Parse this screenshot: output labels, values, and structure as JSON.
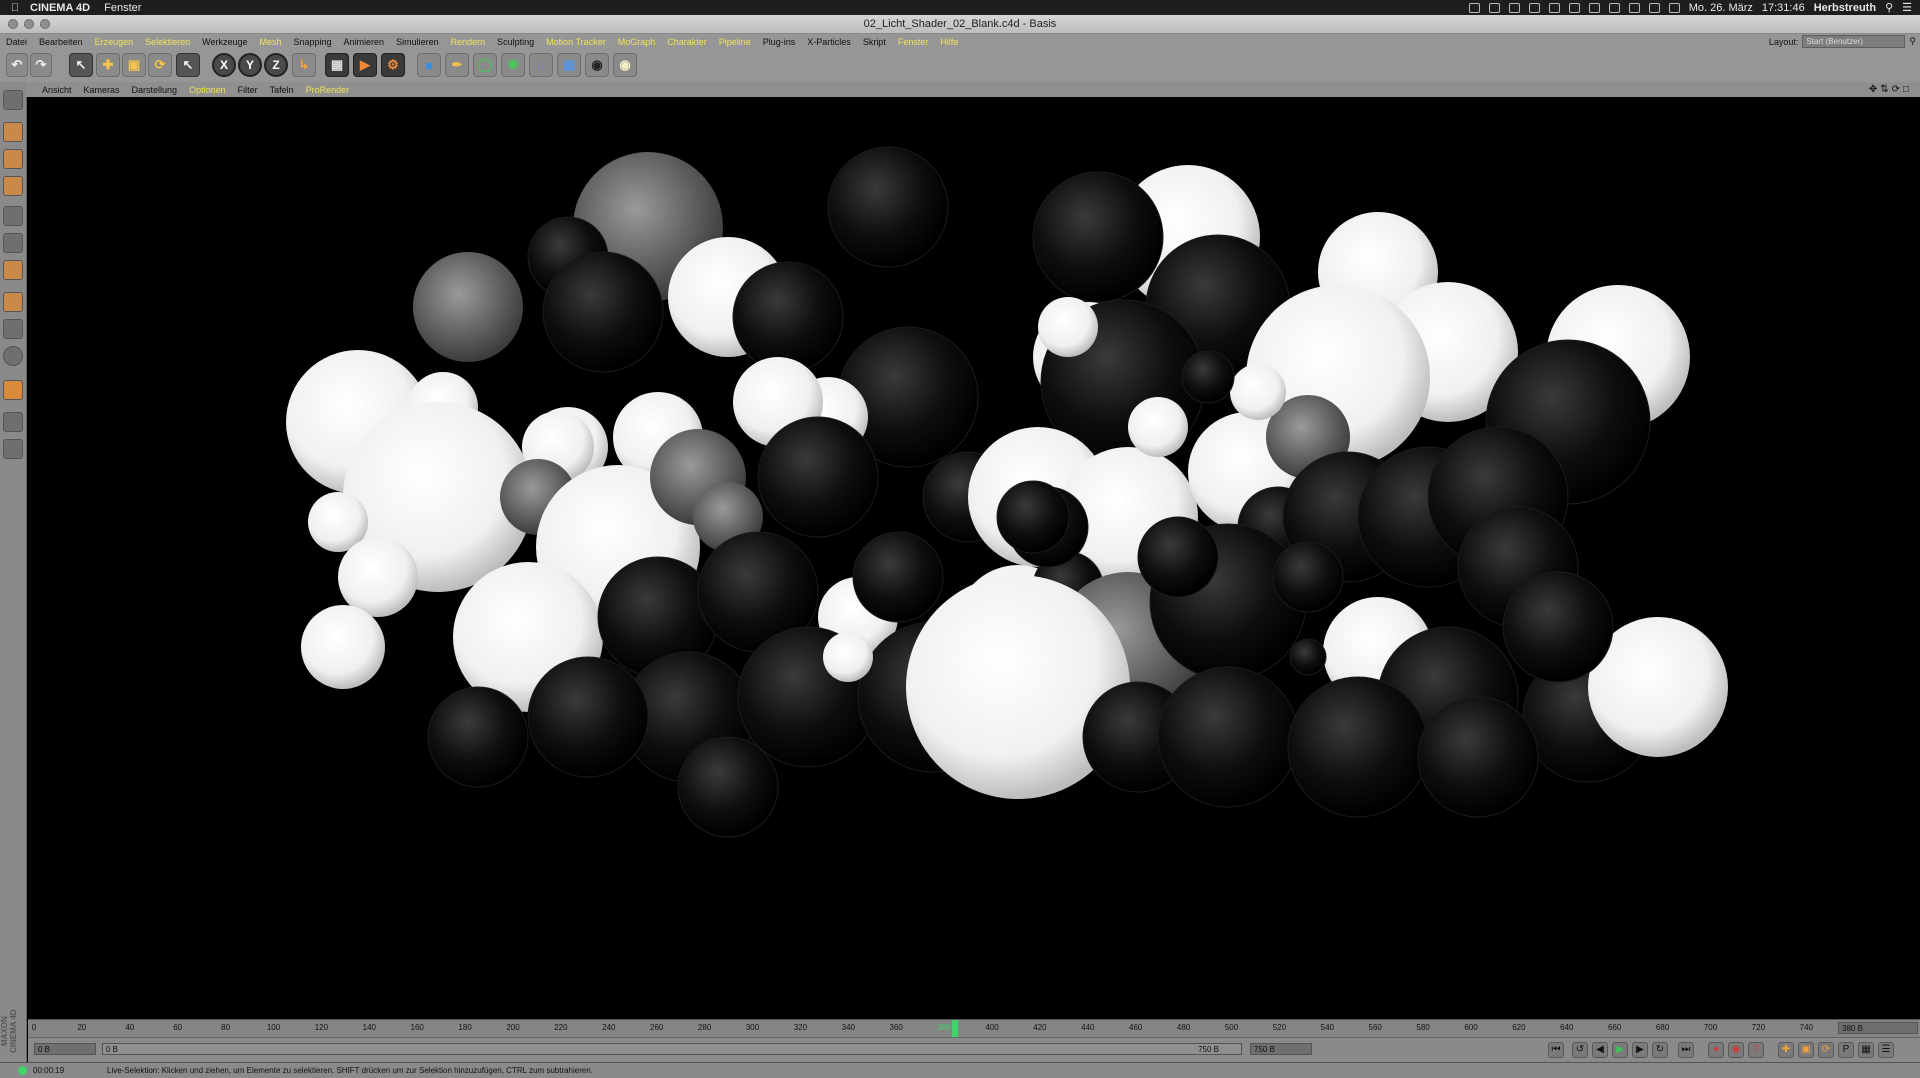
{
  "menubar": {
    "apple": "",
    "app_name": "CINEMA 4D",
    "menu": "Fenster",
    "date": "Mo. 26. März",
    "time": "17:31:46",
    "user": "Herbstreuth"
  },
  "window": {
    "title": "02_Licht_Shader_02_Blank.c4d - Basis"
  },
  "main_menu": [
    {
      "label": "Datei",
      "hl": false
    },
    {
      "label": "Bearbeiten",
      "hl": false
    },
    {
      "label": "Erzeugen",
      "hl": true
    },
    {
      "label": "Selektieren",
      "hl": true
    },
    {
      "label": "Werkzeuge",
      "hl": false
    },
    {
      "label": "Mesh",
      "hl": true
    },
    {
      "label": "Snapping",
      "hl": false
    },
    {
      "label": "Animieren",
      "hl": false
    },
    {
      "label": "Simulieren",
      "hl": false
    },
    {
      "label": "Rendern",
      "hl": true
    },
    {
      "label": "Sculpting",
      "hl": false
    },
    {
      "label": "Motion Tracker",
      "hl": true
    },
    {
      "label": "MoGraph",
      "hl": true
    },
    {
      "label": "Charakter",
      "hl": true
    },
    {
      "label": "Pipeline",
      "hl": true
    },
    {
      "label": "Plug-ins",
      "hl": false
    },
    {
      "label": "X-Particles",
      "hl": false
    },
    {
      "label": "Skript",
      "hl": false
    },
    {
      "label": "Fenster",
      "hl": true
    },
    {
      "label": "Hilfe",
      "hl": true
    }
  ],
  "layout": {
    "label": "Layout:",
    "value": "Start (Benutzer)"
  },
  "toolbar": {
    "x_label": "X",
    "y_label": "Y",
    "z_label": "Z"
  },
  "viewport_menu": [
    {
      "label": "Ansicht",
      "hl": false
    },
    {
      "label": "Kameras",
      "hl": false
    },
    {
      "label": "Darstellung",
      "hl": false
    },
    {
      "label": "Optionen",
      "hl": true
    },
    {
      "label": "Filter",
      "hl": false
    },
    {
      "label": "Tafeln",
      "hl": false
    },
    {
      "label": "ProRender",
      "hl": true
    }
  ],
  "timeline": {
    "ticks": [
      "0",
      "20",
      "40",
      "60",
      "80",
      "100",
      "120",
      "140",
      "160",
      "180",
      "200",
      "220",
      "240",
      "260",
      "280",
      "300",
      "320",
      "340",
      "360",
      "380",
      "400",
      "420",
      "440",
      "460",
      "480",
      "500",
      "520",
      "540",
      "560",
      "580",
      "600",
      "620",
      "640",
      "660",
      "680",
      "700",
      "720",
      "740"
    ],
    "current_frame": "380",
    "current_frame_field": "380 B",
    "start_field": "0 B",
    "start_slider": "0 B",
    "end_slider": "750 B",
    "end_field": "750 B"
  },
  "status": {
    "time": "00:00:19",
    "message": "Live-Selektion: Klicken und ziehen, um Elemente zu selektieren. SHIFT drücken um zur Selektion hinzuzufügen, CTRL zum subtrahieren."
  },
  "brand": "MAXON CINEMA 4D"
}
